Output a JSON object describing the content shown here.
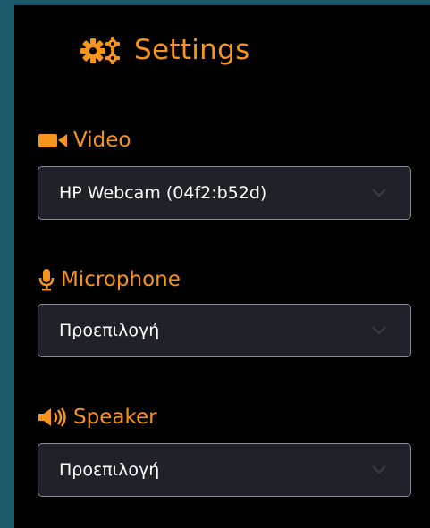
{
  "header": {
    "title": "Settings",
    "icon": "gears-icon"
  },
  "sections": {
    "video": {
      "label": "Video",
      "icon": "video-camera-icon",
      "selected": "HP Webcam (04f2:b52d)"
    },
    "microphone": {
      "label": "Microphone",
      "icon": "microphone-icon",
      "selected": "Προεπιλογή"
    },
    "speaker": {
      "label": "Speaker",
      "icon": "speaker-icon",
      "selected": "Προεπιλογή"
    }
  },
  "colors": {
    "accent": "#f7941d",
    "panel_bg": "#000000",
    "outer_bg": "#1b5a6b",
    "select_bg": "#1f2228",
    "select_border": "#8a8d93"
  }
}
